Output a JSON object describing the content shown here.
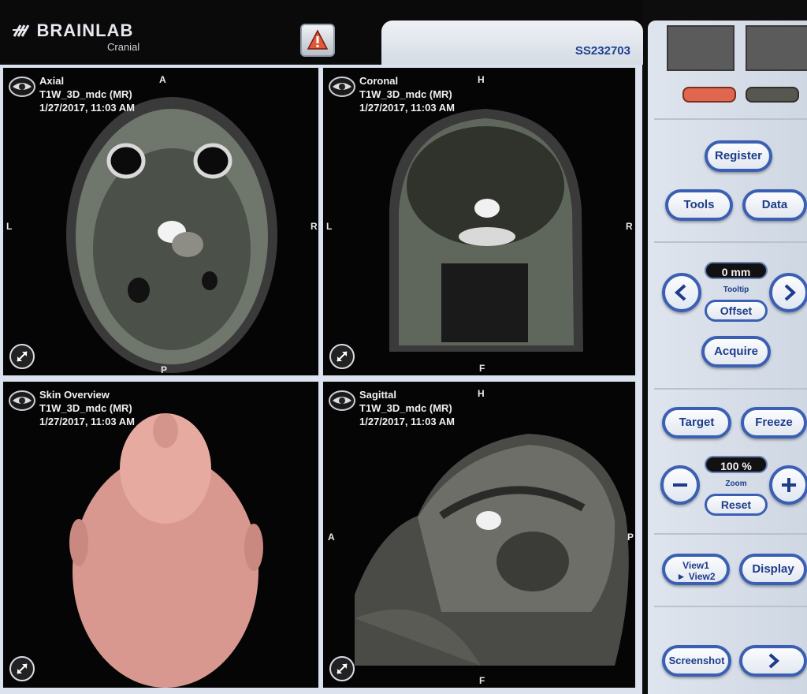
{
  "header": {
    "brand": "BRAINLAB",
    "product": "Cranial",
    "patient_id": "SS232703",
    "warning_icon": "warning-triangle-icon"
  },
  "viewports": [
    {
      "name": "Axial",
      "series": "T1W_3D_mdc (MR)",
      "datetime": "1/27/2017, 11:03 AM",
      "orient_top": "A",
      "orient_bottom": "P",
      "orient_left": "L",
      "orient_right": "R"
    },
    {
      "name": "Coronal",
      "series": "T1W_3D_mdc (MR)",
      "datetime": "1/27/2017, 11:03 AM",
      "orient_top": "H",
      "orient_bottom": "F",
      "orient_left": "L",
      "orient_right": "R"
    },
    {
      "name": "Skin Overview",
      "series": "T1W_3D_mdc (MR)",
      "datetime": "1/27/2017, 11:03 AM"
    },
    {
      "name": "Sagittal",
      "series": "T1W_3D_mdc (MR)",
      "datetime": "1/27/2017, 11:03 AM",
      "orient_top": "H",
      "orient_bottom": "F",
      "orient_left": "A",
      "orient_right": "P"
    }
  ],
  "panel": {
    "register": "Register",
    "tools": "Tools",
    "data": "Data",
    "offset_value": "0 mm",
    "offset_caption": "Tooltip",
    "offset": "Offset",
    "acquire": "Acquire",
    "target": "Target",
    "freeze": "Freeze",
    "zoom_value": "100 %",
    "zoom_caption": "Zoom",
    "reset": "Reset",
    "view1": "View1",
    "view2": "► View2",
    "display": "Display",
    "screenshot": "Screenshot",
    "colors": {
      "accent": "#3a5fb3",
      "indicator_active": "#e0674f",
      "indicator_inactive": "#56584f"
    }
  }
}
